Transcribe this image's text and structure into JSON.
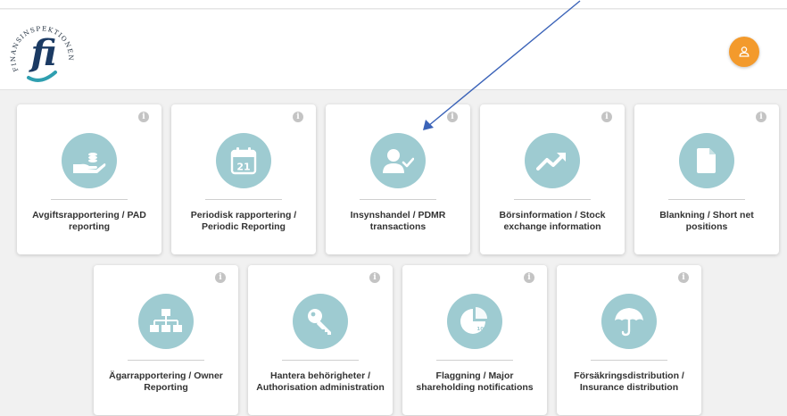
{
  "header": {
    "logo_text": "FINANSINSPEKTIONEN",
    "logo_mark": "fi",
    "avatar_icon": "user-icon",
    "avatar_color": "#f39a2c"
  },
  "accent_color": "#9ecbd1",
  "cards": [
    {
      "label": "Avgiftsrapportering / PAD reporting",
      "icon": "hand-coins-icon"
    },
    {
      "label": "Periodisk rapportering / Periodic Reporting",
      "icon": "calendar-icon"
    },
    {
      "label": "Insynshandel / PDMR transactions",
      "icon": "user-check-icon"
    },
    {
      "label": "Börsinformation / Stock exchange information",
      "icon": "trend-up-icon"
    },
    {
      "label": "Blankning / Short net positions",
      "icon": "document-icon"
    },
    {
      "label": "Ägarrapportering / Owner Reporting",
      "icon": "org-chart-icon"
    },
    {
      "label": "Hantera behörigheter / Authorisation administration",
      "icon": "key-icon"
    },
    {
      "label": "Flaggning / Major shareholding notifications",
      "icon": "pie-chart-icon",
      "badge": "10%"
    },
    {
      "label": "Försäkringsdistribution / Insurance distribution",
      "icon": "umbrella-icon"
    }
  ],
  "info_glyph": "i"
}
